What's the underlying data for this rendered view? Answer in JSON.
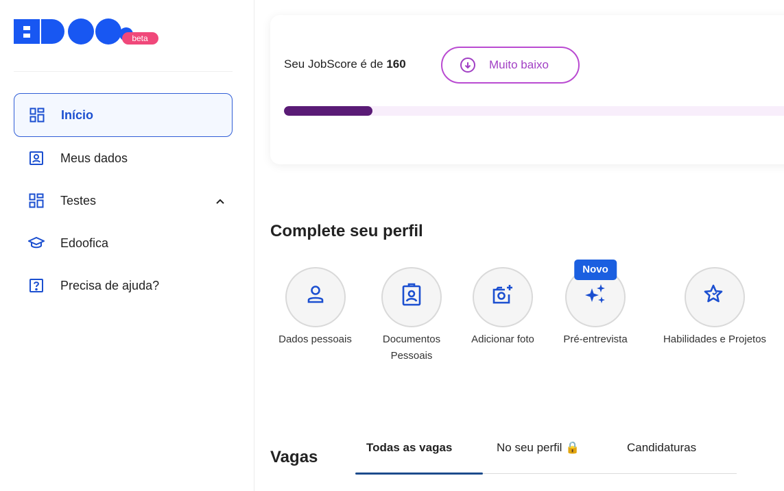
{
  "logo": {
    "text": "EDOO",
    "badge": "beta",
    "colors": {
      "blue": "#1857f2",
      "badge": "#f0487a"
    }
  },
  "sidebar": {
    "items": [
      {
        "label": "Início",
        "icon": "dashboard-icon",
        "active": true
      },
      {
        "label": "Meus dados",
        "icon": "profile-card-icon"
      },
      {
        "label": "Testes",
        "icon": "dashboard-icon",
        "expanded": true
      },
      {
        "label": "Edoofica",
        "icon": "graduation-cap-icon"
      },
      {
        "label": "Precisa de ajuda?",
        "icon": "question-icon"
      }
    ]
  },
  "jobscore": {
    "prefix": "Seu JobScore é de ",
    "value": "160",
    "level_label": "Muito baixo",
    "progress": 0.17
  },
  "profile": {
    "title": "Complete seu perfil",
    "items": [
      {
        "label": "Dados pessoais",
        "icon": "user-icon"
      },
      {
        "label": "Documentos Pessoais",
        "icon": "id-badge-icon"
      },
      {
        "label": "Adicionar foto",
        "icon": "camera-plus-icon"
      },
      {
        "label": "Pré-entrevista",
        "icon": "sparkles-icon",
        "badge": "Novo"
      },
      {
        "label": "Habilidades e Projetos",
        "icon": "star-icon"
      }
    ]
  },
  "vagas": {
    "title": "Vagas",
    "tabs": [
      {
        "label": "Todas as vagas",
        "active": true
      },
      {
        "label": "No seu perfil 🔒"
      },
      {
        "label": "Candidaturas"
      }
    ]
  },
  "colors": {
    "accent": "#1b4fd0",
    "score_pill": "#a13fc4",
    "progress_fill": "#5a1b76"
  }
}
